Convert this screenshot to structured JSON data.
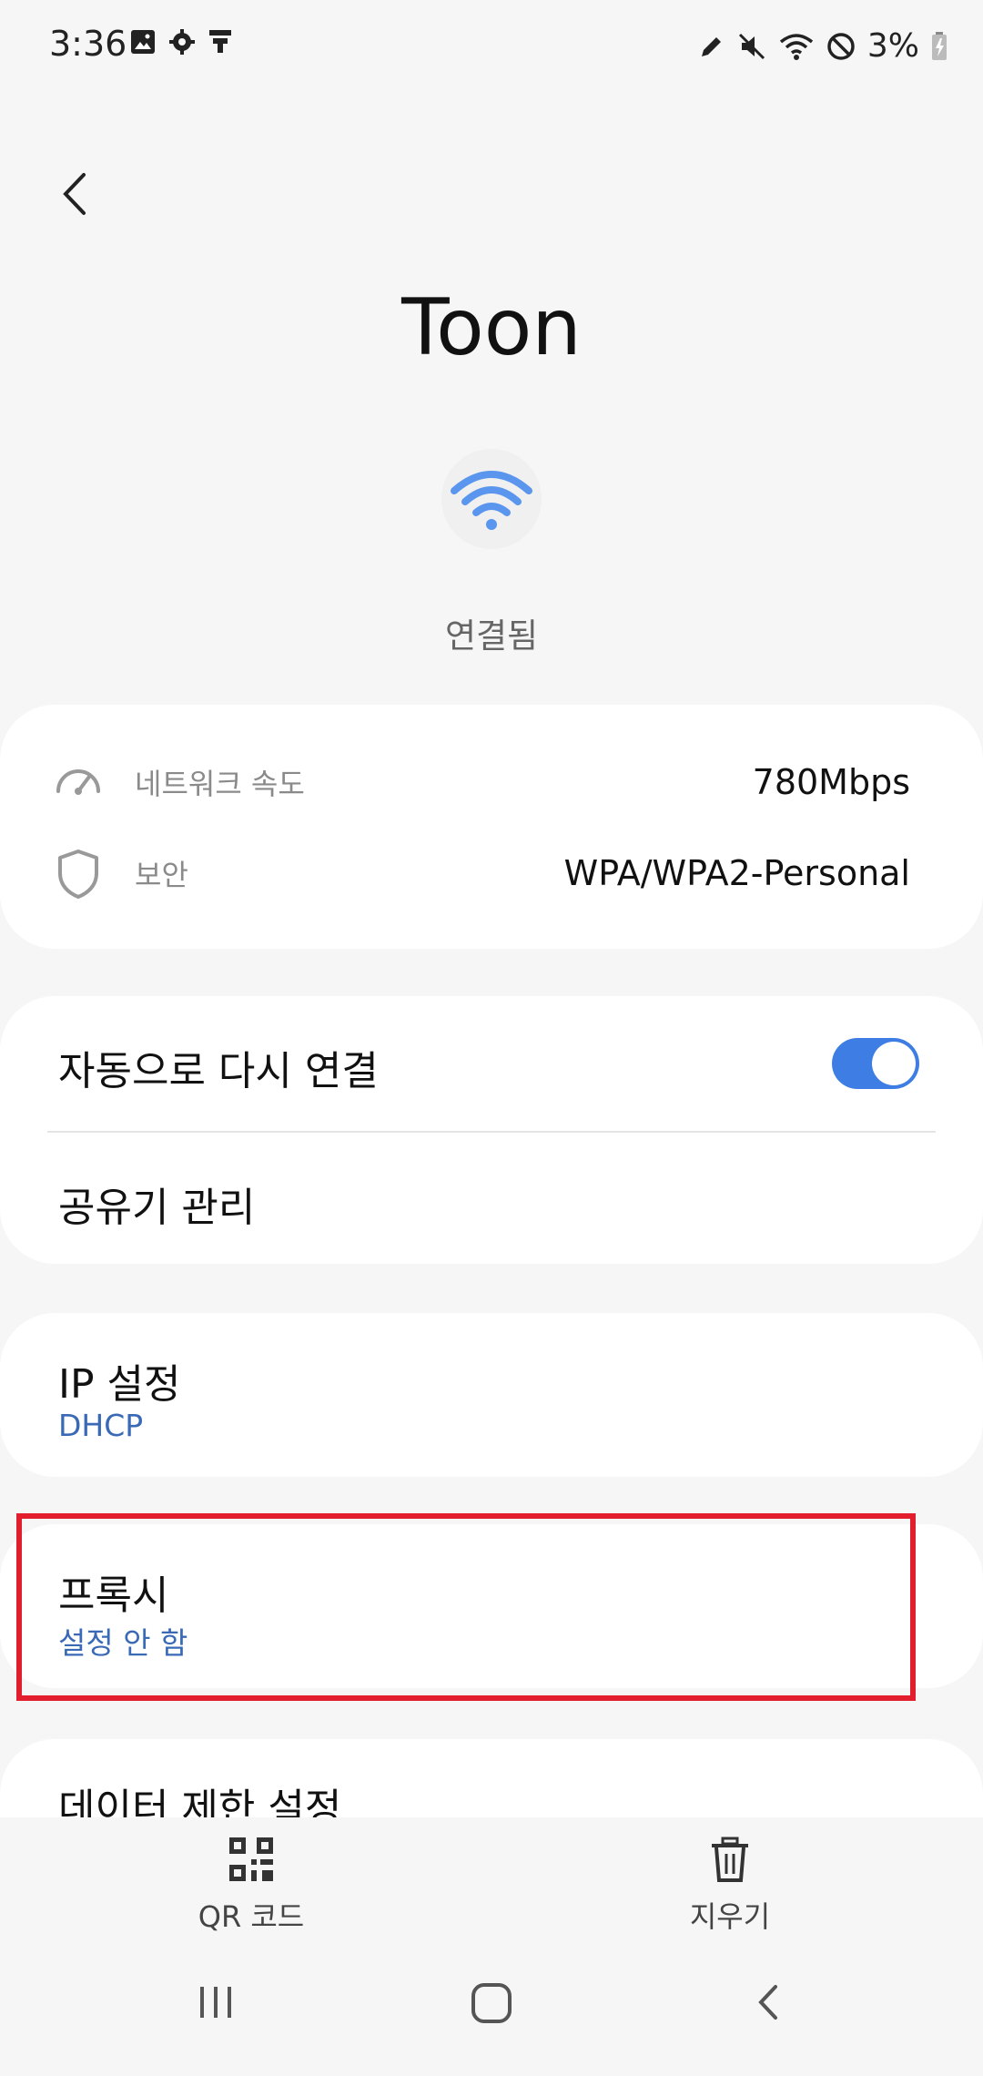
{
  "status": {
    "time": "3:36",
    "battery": "3%",
    "left_icons": [
      "image-icon",
      "gear-icon",
      "notification-icon"
    ],
    "right_icons": [
      "pen-icon",
      "mute-icon",
      "wifi-icon",
      "block-icon",
      "battery-icon"
    ]
  },
  "header": {
    "title": "Toon",
    "connection_status": "연결됨"
  },
  "info": {
    "speed_label": "네트워크 속도",
    "speed_value": "780Mbps",
    "security_label": "보안",
    "security_value": "WPA/WPA2-Personal"
  },
  "settings": {
    "auto_reconnect": "자동으로 다시 연결",
    "auto_reconnect_on": true,
    "router_manage": "공유기 관리",
    "ip_label": "IP 설정",
    "ip_value": "DHCP",
    "proxy_label": "프록시",
    "proxy_value": "설정 안 함",
    "data_limit": "데이터 제한 설정"
  },
  "actions": {
    "qr": "QR 코드",
    "delete": "지우기"
  },
  "colors": {
    "accent": "#3e7de3",
    "link": "#3a6ab6",
    "highlight": "#e11d2e"
  }
}
